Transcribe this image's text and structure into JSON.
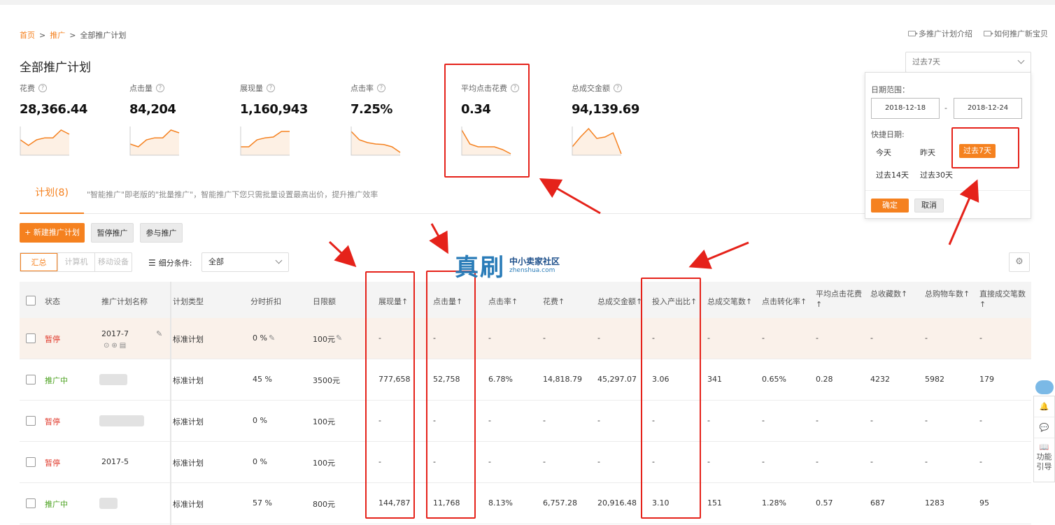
{
  "breadcrumb": {
    "home": "首页",
    "promo": "推广",
    "current": "全部推广计划",
    "sep": ">"
  },
  "help_links": [
    "多推广计划介绍",
    "如何推广新宝贝"
  ],
  "page_title": "全部推广计划",
  "metrics": [
    {
      "label": "花费",
      "value": "28,366.44",
      "trend": [
        0.55,
        0.35,
        0.55,
        0.62,
        0.62,
        0.9,
        0.75
      ]
    },
    {
      "label": "点击量",
      "value": "84,204",
      "trend": [
        0.4,
        0.3,
        0.55,
        0.62,
        0.62,
        0.9,
        0.8
      ]
    },
    {
      "label": "展现量",
      "value": "1,160,943",
      "trend": [
        0.3,
        0.3,
        0.55,
        0.62,
        0.65,
        0.85,
        0.85
      ]
    },
    {
      "label": "点击率",
      "value": "7.25%",
      "trend": [
        0.85,
        0.55,
        0.45,
        0.4,
        0.38,
        0.3,
        0.1
      ]
    },
    {
      "label": "平均点击花费",
      "value": "0.34",
      "trend": [
        0.9,
        0.4,
        0.3,
        0.3,
        0.3,
        0.2,
        0.05
      ]
    },
    {
      "label": "总成交金额",
      "value": "94,139.69",
      "trend": [
        0.3,
        0.65,
        0.95,
        0.6,
        0.65,
        0.8,
        0.05
      ]
    }
  ],
  "tabs": {
    "active": "计划(8)",
    "note": "\"智能推广\"即老版的\"批量推广\"，智能推广下您只需批量设置最高出价，提升推广效率"
  },
  "toolbar": {
    "new_plan": "+ 新建推广计划",
    "pause": "暂停推广",
    "join": "参与推广"
  },
  "device_seg": [
    "汇总",
    "计算机",
    "移动设备"
  ],
  "filter": {
    "label": "细分条件:",
    "value": "全部"
  },
  "date_select": "过去7天",
  "columns": [
    "状态",
    "推广计划名称",
    "计划类型",
    "分时折扣",
    "日限额",
    "展现量↑",
    "点击量↑",
    "点击率↑",
    "花费↑",
    "总成交金额↑",
    "投入产出比↑",
    "总成交笔数↑",
    "点击转化率↑",
    "平均点击花费 ↑",
    "总收藏数↑",
    "总购物车数↑",
    "直接成交笔数 ↑"
  ],
  "rows": [
    {
      "status": "暂停",
      "name": "2017-7",
      "type": "标准计划",
      "discount": "0 %",
      "limit": "100元",
      "impr": "-",
      "clicks": "-",
      "ctr": "-",
      "cost": "-",
      "gmv": "-",
      "roi": "-",
      "orders": "-",
      "cvr": "-",
      "cpc": "-",
      "fav": "-",
      "cart": "-",
      "direct": "-"
    },
    {
      "status": "推广中",
      "name": "",
      "type": "标准计划",
      "discount": "45 %",
      "limit": "3500元",
      "impr": "777,658",
      "clicks": "52,758",
      "ctr": "6.78%",
      "cost": "14,818.79",
      "gmv": "45,297.07",
      "roi": "3.06",
      "orders": "341",
      "cvr": "0.65%",
      "cpc": "0.28",
      "fav": "4232",
      "cart": "5982",
      "direct": "179"
    },
    {
      "status": "暂停",
      "name": "",
      "type": "标准计划",
      "discount": "0 %",
      "limit": "100元",
      "impr": "-",
      "clicks": "-",
      "ctr": "-",
      "cost": "-",
      "gmv": "-",
      "roi": "-",
      "orders": "-",
      "cvr": "-",
      "cpc": "-",
      "fav": "-",
      "cart": "-",
      "direct": "-"
    },
    {
      "status": "暂停",
      "name": "2017-5",
      "type": "标准计划",
      "discount": "0 %",
      "limit": "100元",
      "impr": "-",
      "clicks": "-",
      "ctr": "-",
      "cost": "-",
      "gmv": "-",
      "roi": "-",
      "orders": "-",
      "cvr": "-",
      "cpc": "-",
      "fav": "-",
      "cart": "-",
      "direct": "-"
    },
    {
      "status": "推广中",
      "name": "",
      "type": "标准计划",
      "discount": "57 %",
      "limit": "800元",
      "impr": "144,787",
      "clicks": "11,768",
      "ctr": "8.13%",
      "cost": "6,757.28",
      "gmv": "20,916.48",
      "roi": "3.10",
      "orders": "151",
      "cvr": "1.28%",
      "cpc": "0.57",
      "fav": "687",
      "cart": "1283",
      "direct": "95"
    }
  ],
  "date_panel": {
    "range_label": "日期范围：",
    "start": "2018-12-18",
    "end": "2018-12-24",
    "dash": "-",
    "quick_label": "快捷日期:",
    "quick": [
      "今天",
      "昨天",
      "过去7天",
      "过去14天",
      "过去30天"
    ],
    "ok": "确定",
    "cancel": "取消"
  },
  "watermark": {
    "big": "真刷",
    "cn": "中小卖家社区",
    "en": "zhenshua.com"
  },
  "side_tools": {
    "guide": "功能引导"
  },
  "colors": {
    "accent": "#f5811f",
    "annotation": "#e5221a",
    "status_stop": "#e03a2c",
    "status_run": "#4aa11e"
  }
}
